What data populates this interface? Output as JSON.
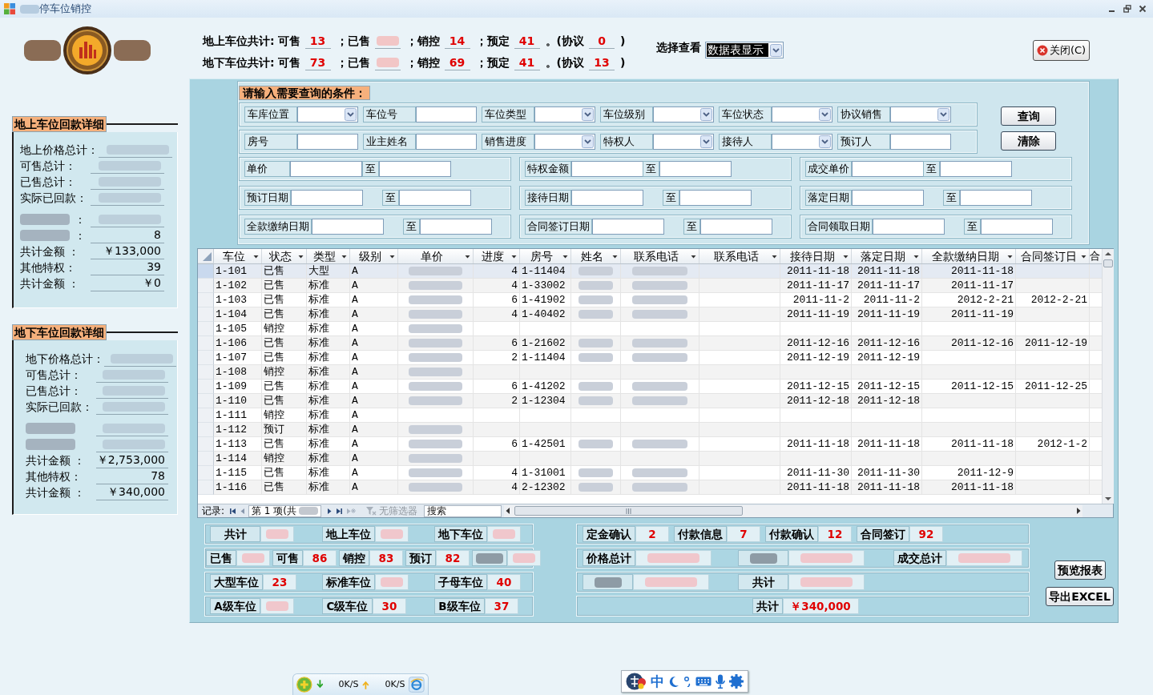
{
  "window": {
    "title": [
      {
        "redacted": true
      },
      "停车位销控"
    ]
  },
  "logo": [
    {
      "redacted": true
    },
    {
      "kind": "emblem"
    },
    {
      "redacted": true
    }
  ],
  "totals": [
    {
      "label": "地上车位共计:",
      "items": [
        {
          "label": "可售",
          "value": "13"
        },
        {
          "label": "；已售",
          "value": {
            "redacted": true
          }
        },
        {
          "label": "；销控",
          "value": "14"
        },
        {
          "label": "；预定",
          "value": "41"
        },
        {
          "label": "。(协议",
          "value": "0"
        }
      ],
      "end": ")"
    },
    {
      "label": "地下车位共计:",
      "items": [
        {
          "label": "可售",
          "value": "73"
        },
        {
          "label": "；已售",
          "value": {
            "redacted": true
          }
        },
        {
          "label": "；销控",
          "value": "69"
        },
        {
          "label": "；预定",
          "value": "41"
        },
        {
          "label": "。(协议",
          "value": "13"
        }
      ],
      "end": ")"
    }
  ],
  "view_select": {
    "label": "选择查看",
    "value": "数据表显示"
  },
  "close_button": "关闭(C)",
  "detail_panels": [
    {
      "title": "地上车位回款详细",
      "rows": [
        {
          "label": "地上价格总计：",
          "value": {
            "redacted": true
          }
        },
        {
          "label": "可售总计：",
          "value": {
            "redacted": true
          }
        },
        {
          "label": "已售总计：",
          "value": {
            "redacted": true
          }
        },
        {
          "label": "实际已回款：",
          "value": {
            "redacted": true
          }
        },
        {
          "label": {
            "redacted": true
          },
          "colon": "：",
          "value": {
            "redacted": true
          }
        },
        {
          "label": {
            "redacted": true
          },
          "colon": "：",
          "value": "8"
        },
        {
          "label": "共计金额 ：",
          "value": "￥133,000"
        },
        {
          "label": "其他特权：",
          "value": "39"
        },
        {
          "label": "共计金额 ：",
          "value": "￥0"
        }
      ]
    },
    {
      "title": "地下车位回款详细",
      "rows": [
        {
          "label": "地下价格总计：",
          "value": {
            "redacted": true
          }
        },
        {
          "label": "可售总计：",
          "value": {
            "redacted": true
          }
        },
        {
          "label": "已售总计：",
          "value": {
            "redacted": true
          }
        },
        {
          "label": "实际已回款：",
          "value": {
            "redacted": true
          }
        },
        {
          "label": {
            "redacted": true
          },
          "value": {
            "redacted": true
          }
        },
        {
          "label": {
            "redacted": true
          },
          "value": {
            "redacted": true
          }
        },
        {
          "label": "共计金额 ：",
          "value": "￥2,753,000"
        },
        {
          "label": "其他特权：",
          "value": "78"
        },
        {
          "label": "共计金额 ：",
          "value": "￥340,000"
        }
      ]
    }
  ],
  "filters": {
    "title": "请输入需要查询的条件：",
    "rows": [
      [
        {
          "label": "车库位置",
          "kind": "combo"
        },
        {
          "label": "车位号",
          "kind": "text"
        },
        {
          "label": "车位类型",
          "kind": "combo"
        },
        {
          "label": "车位级别",
          "kind": "combo"
        },
        {
          "label": "车位状态",
          "kind": "combo"
        },
        {
          "label": "协议销售",
          "kind": "combo"
        }
      ],
      [
        {
          "label": "房号",
          "kind": "text"
        },
        {
          "label": "业主姓名",
          "kind": "text"
        },
        {
          "label": "销售进度",
          "kind": "combo"
        },
        {
          "label": "特权人",
          "kind": "combo"
        },
        {
          "label": "接待人",
          "kind": "combo"
        },
        {
          "label": "预订人",
          "kind": "text"
        }
      ]
    ],
    "ranges": [
      [
        {
          "label": "单价",
          "to": "至"
        },
        {
          "label": "特权金额",
          "to": "至"
        },
        {
          "label": "成交单价",
          "to": "至"
        }
      ],
      [
        {
          "label": "预订日期",
          "to": "至"
        },
        {
          "label": "接待日期",
          "to": "至"
        },
        {
          "label": "落定日期",
          "to": "至"
        }
      ],
      [
        {
          "label": "全款缴纳日期",
          "to": "至"
        },
        {
          "label": "合同签订日期",
          "to": "至"
        },
        {
          "label": "合同领取日期",
          "to": "至"
        }
      ]
    ],
    "buttons": [
      "查询",
      "清除"
    ]
  },
  "table": {
    "columns": [
      {
        "label": "车位",
        "kind": "menu"
      },
      {
        "label": "状态",
        "kind": "menu"
      },
      {
        "label": "类型",
        "kind": "menu"
      },
      {
        "label": "级别",
        "kind": "menu"
      },
      {
        "label": "单价",
        "kind": "menu"
      },
      {
        "label": "进度",
        "kind": "menu"
      },
      {
        "label": "房号",
        "kind": "menu"
      },
      {
        "label": "姓名",
        "kind": "menu"
      },
      {
        "label": "联系电话",
        "kind": "menu"
      },
      {
        "label": "联系电话",
        "kind": "menu"
      },
      {
        "label": "接待日期",
        "kind": "menu"
      },
      {
        "label": "落定日期",
        "kind": "menu"
      },
      {
        "label": "全款缴纳日期",
        "kind": "menu"
      },
      {
        "label": "合同签订日",
        "kind": "menu"
      },
      {
        "label": "合",
        "kind": "clipped"
      }
    ],
    "rows": [
      {
        "selected": true,
        "cells": [
          "1-101",
          "已售",
          "大型",
          "A",
          {
            "redacted": true
          },
          "4",
          "1-11404",
          {
            "redacted": true
          },
          {
            "redacted": true
          },
          null,
          "2011-11-18",
          "2011-11-18",
          "2011-11-18",
          null,
          null
        ]
      },
      {
        "selected": false,
        "cells": [
          "1-102",
          "已售",
          "标准",
          "A",
          {
            "redacted": true
          },
          "4",
          "1-33002",
          {
            "redacted": true
          },
          {
            "redacted": true
          },
          null,
          "2011-11-17",
          "2011-11-17",
          "2011-11-17",
          null,
          null
        ]
      },
      {
        "selected": false,
        "cells": [
          "1-103",
          "已售",
          "标准",
          "A",
          {
            "redacted": true
          },
          "6",
          "1-41902",
          {
            "redacted": true
          },
          {
            "redacted": true
          },
          null,
          "2011-11-2",
          "2011-11-2",
          "2012-2-21",
          "2012-2-21",
          null
        ]
      },
      {
        "selected": false,
        "cells": [
          "1-104",
          "已售",
          "标准",
          "A",
          {
            "redacted": true
          },
          "4",
          "1-40402",
          {
            "redacted": true
          },
          {
            "redacted": true
          },
          null,
          "2011-11-19",
          "2011-11-19",
          "2011-11-19",
          null,
          null
        ]
      },
      {
        "selected": false,
        "cells": [
          "1-105",
          "销控",
          "标准",
          "A",
          {
            "redacted": true
          },
          null,
          null,
          null,
          null,
          null,
          null,
          null,
          null,
          null,
          null
        ]
      },
      {
        "selected": false,
        "cells": [
          "1-106",
          "已售",
          "标准",
          "A",
          {
            "redacted": true
          },
          "6",
          "1-21602",
          {
            "redacted": true
          },
          {
            "redacted": true
          },
          null,
          "2011-12-16",
          "2011-12-16",
          "2011-12-16",
          "2011-12-19",
          null
        ]
      },
      {
        "selected": false,
        "cells": [
          "1-107",
          "已售",
          "标准",
          "A",
          {
            "redacted": true
          },
          "2",
          "1-11404",
          {
            "redacted": true
          },
          {
            "redacted": true
          },
          null,
          "2011-12-19",
          "2011-12-19",
          null,
          null,
          null
        ]
      },
      {
        "selected": false,
        "cells": [
          "1-108",
          "销控",
          "标准",
          "A",
          {
            "redacted": true
          },
          null,
          null,
          null,
          null,
          null,
          null,
          null,
          null,
          null,
          null
        ]
      },
      {
        "selected": false,
        "cells": [
          "1-109",
          "已售",
          "标准",
          "A",
          {
            "redacted": true
          },
          "6",
          "1-41202",
          {
            "redacted": true
          },
          {
            "redacted": true
          },
          null,
          "2011-12-15",
          "2011-12-15",
          "2011-12-15",
          "2011-12-25",
          null
        ]
      },
      {
        "selected": false,
        "cells": [
          "1-110",
          "已售",
          "标准",
          "A",
          {
            "redacted": true
          },
          "2",
          "1-12304",
          {
            "redacted": true
          },
          {
            "redacted": true
          },
          null,
          "2011-12-18",
          "2011-12-18",
          null,
          null,
          null
        ]
      },
      {
        "selected": false,
        "cells": [
          "1-111",
          "销控",
          "标准",
          "A",
          null,
          null,
          null,
          null,
          null,
          null,
          null,
          null,
          null,
          null,
          null
        ]
      },
      {
        "selected": false,
        "cells": [
          "1-112",
          "预订",
          "标准",
          "A",
          {
            "redacted": true
          },
          null,
          null,
          null,
          null,
          null,
          null,
          null,
          null,
          null,
          null
        ]
      },
      {
        "selected": false,
        "cells": [
          "1-113",
          "已售",
          "标准",
          "A",
          {
            "redacted": true
          },
          "6",
          "1-42501",
          {
            "redacted": true
          },
          {
            "redacted": true
          },
          null,
          "2011-11-18",
          "2011-11-18",
          "2011-11-18",
          "2012-1-2",
          null
        ]
      },
      {
        "selected": false,
        "cells": [
          "1-114",
          "销控",
          "标准",
          "A",
          {
            "redacted": true
          },
          null,
          null,
          null,
          null,
          null,
          null,
          null,
          null,
          null,
          null
        ]
      },
      {
        "selected": false,
        "cells": [
          "1-115",
          "已售",
          "标准",
          "A",
          {
            "redacted": true
          },
          "4",
          "1-31001",
          {
            "redacted": true
          },
          {
            "redacted": true
          },
          null,
          "2011-11-30",
          "2011-11-30",
          "2011-12-9",
          null,
          null
        ]
      },
      {
        "selected": false,
        "cells": [
          "1-116",
          "已售",
          "标准",
          "A",
          {
            "redacted": true
          },
          "4",
          "2-12302",
          {
            "redacted": true
          },
          {
            "redacted": true
          },
          null,
          "2011-11-18",
          "2011-11-18",
          "2011-11-18",
          null,
          null
        ]
      }
    ]
  },
  "navigator": {
    "label": "记录:",
    "position": "第 1 项(共",
    "total": {
      "redacted": true
    },
    "filter": "无筛选器",
    "search_placeholder": "搜索"
  },
  "counts": {
    "left": [
      {
        "kind": "slots",
        "items": [
          {
            "label": "共计",
            "value": {
              "redacted": true
            }
          },
          {
            "label": "地上车位",
            "value": {
              "redacted": true
            }
          },
          {
            "label": "地下车位",
            "value": {
              "redacted": true
            }
          }
        ]
      },
      {
        "kind": "strip",
        "items": [
          {
            "label": "已售",
            "value": {
              "redacted": true
            }
          },
          {
            "label": "可售",
            "value": "86"
          },
          {
            "label": "销控",
            "value": "83"
          },
          {
            "label": "预订",
            "value": "82"
          },
          {
            "label": {
              "redacted": true
            },
            "value": {
              "redacted": true
            }
          }
        ]
      },
      {
        "kind": "slots",
        "items": [
          {
            "label": "大型车位",
            "value": "23"
          },
          {
            "label": "标准车位",
            "value": {
              "redacted": true
            }
          },
          {
            "label": "子母车位",
            "value": "40"
          }
        ]
      },
      {
        "kind": "slots",
        "items": [
          {
            "label": "A级车位",
            "value": {
              "redacted": true
            }
          },
          {
            "label": "C级车位",
            "value": "30"
          },
          {
            "label": "B级车位",
            "value": "37"
          }
        ]
      }
    ],
    "right": [
      {
        "kind": "strip",
        "items": [
          {
            "label": "定金确认",
            "value": "2"
          },
          {
            "label": "付款信息",
            "value": "7"
          },
          {
            "label": "付款确认",
            "value": "12"
          },
          {
            "label": "合同签订",
            "value": "92"
          }
        ]
      },
      {
        "kind": "slots",
        "items": [
          {
            "label": "价格总计",
            "value": {
              "redacted": true
            }
          },
          {
            "label": {
              "redacted": true
            },
            "value": {
              "redacted": true
            }
          },
          {
            "label": "成交总计",
            "value": {
              "redacted": true
            }
          }
        ]
      },
      {
        "kind": "slots",
        "items": [
          {
            "label": {
              "redacted": true
            },
            "value": {
              "redacted": true
            }
          },
          {
            "label": "共计",
            "value": {
              "redacted": true
            }
          }
        ]
      },
      {
        "kind": "center",
        "items": [
          {
            "label": "共计",
            "value": "￥340,000"
          }
        ]
      }
    ]
  },
  "report_buttons": [
    "预览报表",
    "导出EXCEL"
  ],
  "net_monitor": {
    "download": "0K/S",
    "upload": "0K/S"
  },
  "ime_bar": {
    "mode": "中"
  }
}
